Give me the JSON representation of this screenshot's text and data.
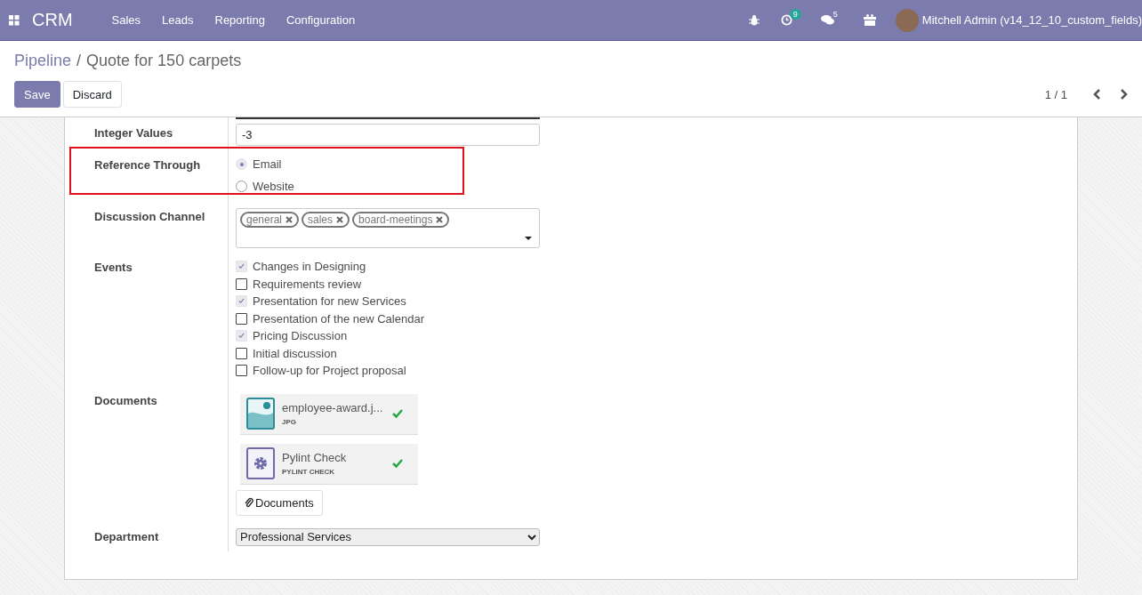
{
  "navbar": {
    "app": "CRM",
    "menu": [
      "Sales",
      "Leads",
      "Reporting",
      "Configuration"
    ],
    "activity_count": "9",
    "message_count": "5",
    "user": "Mitchell Admin (v14_12_10_custom_fields)"
  },
  "breadcrumb": {
    "parent": "Pipeline",
    "separator": "/",
    "current": "Quote for 150 carpets"
  },
  "buttons": {
    "save": "Save",
    "discard": "Discard"
  },
  "pager": "1 / 1",
  "form": {
    "integer_values": {
      "label": "Integer Values",
      "value": "-3"
    },
    "reference_through": {
      "label": "Reference Through",
      "highlighted": true,
      "options": [
        {
          "label": "Email",
          "selected": true
        },
        {
          "label": "Website",
          "selected": false
        }
      ]
    },
    "discussion_channel": {
      "label": "Discussion Channel",
      "tags": [
        "general",
        "sales",
        "board-meetings"
      ]
    },
    "events": {
      "label": "Events",
      "items": [
        {
          "label": "Changes in Designing",
          "checked": true
        },
        {
          "label": "Requirements review",
          "checked": false
        },
        {
          "label": "Presentation for new Services",
          "checked": true
        },
        {
          "label": "Presentation of the new Calendar",
          "checked": false
        },
        {
          "label": "Pricing Discussion",
          "checked": true
        },
        {
          "label": "Initial discussion",
          "checked": false
        },
        {
          "label": "Follow-up for Project proposal",
          "checked": false
        }
      ]
    },
    "documents": {
      "label": "Documents",
      "files": [
        {
          "kind": "image",
          "name": "employee-award.j...",
          "type": "JPG",
          "done": true
        },
        {
          "kind": "gear",
          "name": "Pylint Check",
          "type": "PYLINT CHECK",
          "done": true
        }
      ],
      "button": "Documents"
    },
    "department": {
      "label": "Department",
      "value": "Professional Services"
    }
  }
}
